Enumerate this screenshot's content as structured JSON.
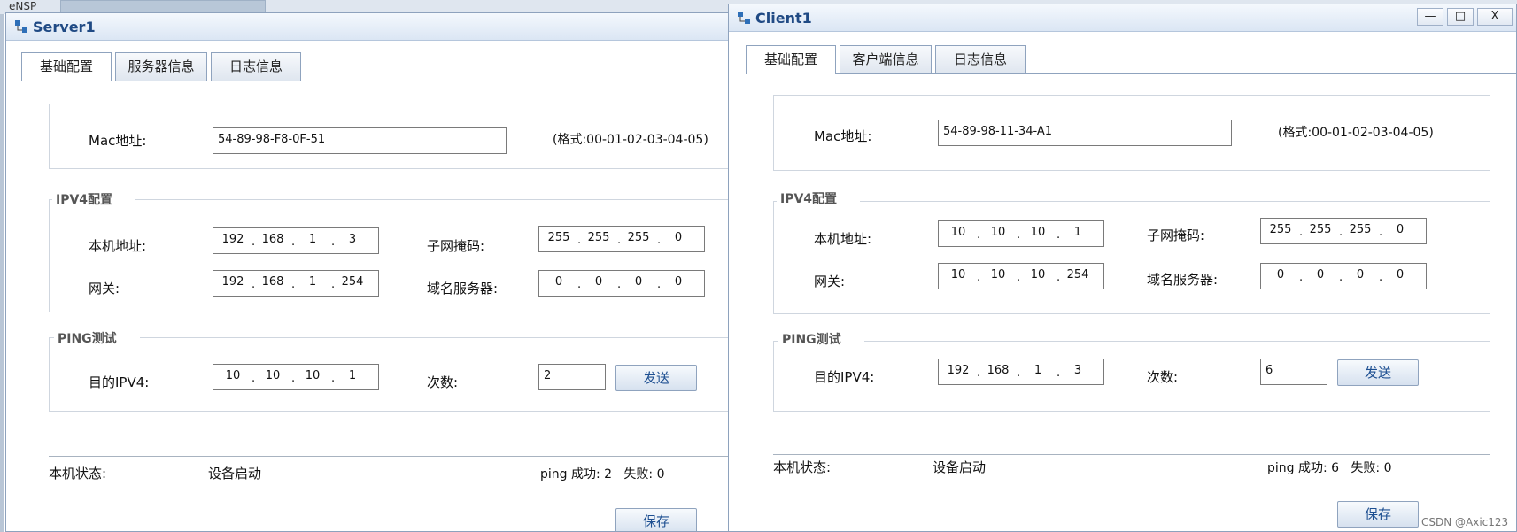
{
  "background": {
    "app_label": "eNSP"
  },
  "server": {
    "title": "Server1",
    "tabs": [
      "基础配置",
      "服务器信息",
      "日志信息"
    ],
    "mac_label": "Mac地址:",
    "mac_value": "54-89-98-F8-0F-51",
    "mac_format": "(格式:00-01-02-03-04-05)",
    "ipv4_legend": "IPV4配置",
    "local_ip_label": "本机地址:",
    "local_ip": [
      "192",
      "168",
      "1",
      "3"
    ],
    "mask_label": "子网掩码:",
    "mask": [
      "255",
      "255",
      "255",
      "0"
    ],
    "gateway_label": "网关:",
    "gateway": [
      "192",
      "168",
      "1",
      "254"
    ],
    "dns_label": "域名服务器:",
    "dns": [
      "0",
      "0",
      "0",
      "0"
    ],
    "ping_legend": "PING测试",
    "dest_label": "目的IPV4:",
    "dest": [
      "10",
      "10",
      "10",
      "1"
    ],
    "count_label": "次数:",
    "count_value": "2",
    "send_label": "发送",
    "status_label": "本机状态:",
    "status_value": "设备启动",
    "ping_result": "ping 成功: 2   失败: 0",
    "save_label": "保存"
  },
  "client": {
    "title": "Client1",
    "tabs": [
      "基础配置",
      "客户端信息",
      "日志信息"
    ],
    "mac_label": "Mac地址:",
    "mac_value": "54-89-98-11-34-A1",
    "mac_format": "(格式:00-01-02-03-04-05)",
    "ipv4_legend": "IPV4配置",
    "local_ip_label": "本机地址:",
    "local_ip": [
      "10",
      "10",
      "10",
      "1"
    ],
    "mask_label": "子网掩码:",
    "mask": [
      "255",
      "255",
      "255",
      "0"
    ],
    "gateway_label": "网关:",
    "gateway": [
      "10",
      "10",
      "10",
      "254"
    ],
    "dns_label": "域名服务器:",
    "dns": [
      "0",
      "0",
      "0",
      "0"
    ],
    "ping_legend": "PING测试",
    "dest_label": "目的IPV4:",
    "dest": [
      "192",
      "168",
      "1",
      "3"
    ],
    "count_label": "次数:",
    "count_value": "6",
    "send_label": "发送",
    "status_label": "本机状态:",
    "status_value": "设备启动",
    "ping_result": "ping 成功: 6   失败: 0",
    "save_label": "保存",
    "controls": {
      "minimize": "—",
      "maximize": "□",
      "close": "X"
    }
  },
  "watermark": "CSDN @Axic123"
}
